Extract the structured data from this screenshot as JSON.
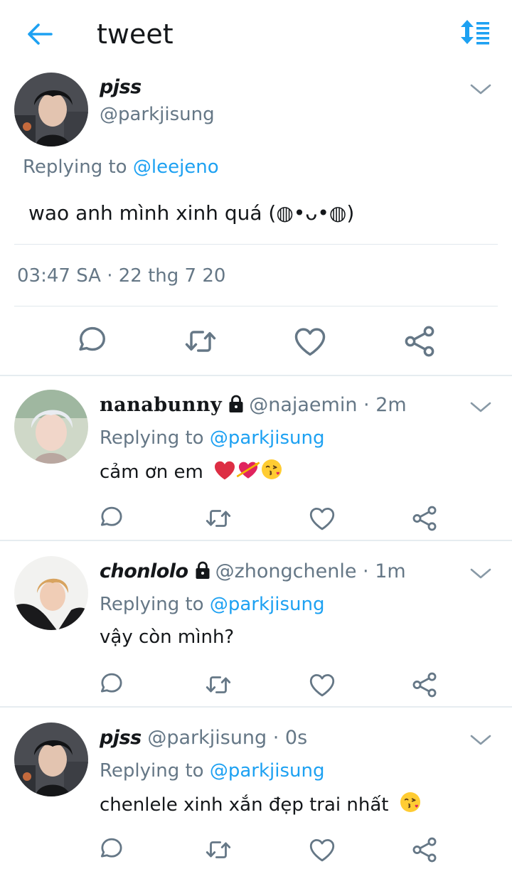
{
  "header": {
    "title": "tweet",
    "back_icon": "back-arrow-icon",
    "sort_icon": "sort-icon"
  },
  "colors": {
    "accent": "#1da1f2",
    "muted": "#657786",
    "text": "#14171a",
    "divider": "#e1e8ed",
    "heart": "#e0245e"
  },
  "main_tweet": {
    "name": "pjss",
    "handle": "@parkjisung",
    "replying_prefix": "Replying to ",
    "replying_to": "@leejeno",
    "text": "wao anh mình xinh quá (◍•ᴗ•◍)",
    "timestamp": "03:47 SA · 22 thg 7 20"
  },
  "replies": [
    {
      "name": "nanabunny",
      "handle": "@najaemin · 2m",
      "replying_prefix": "Replying to ",
      "replying_to": "@parkjisung",
      "text": "cảm ơn em"
    },
    {
      "name": "chonlolo",
      "handle": "@zhongchenle · 1m",
      "replying_prefix": "Replying to ",
      "replying_to": "@parkjisung",
      "text": "vậy còn mình?"
    },
    {
      "name": "pjss",
      "handle": "@parkjisung · 0s",
      "replying_prefix": "Replying to ",
      "replying_to": "@parkjisung",
      "text": "chenlele xinh xắn đẹp trai nhất"
    }
  ]
}
